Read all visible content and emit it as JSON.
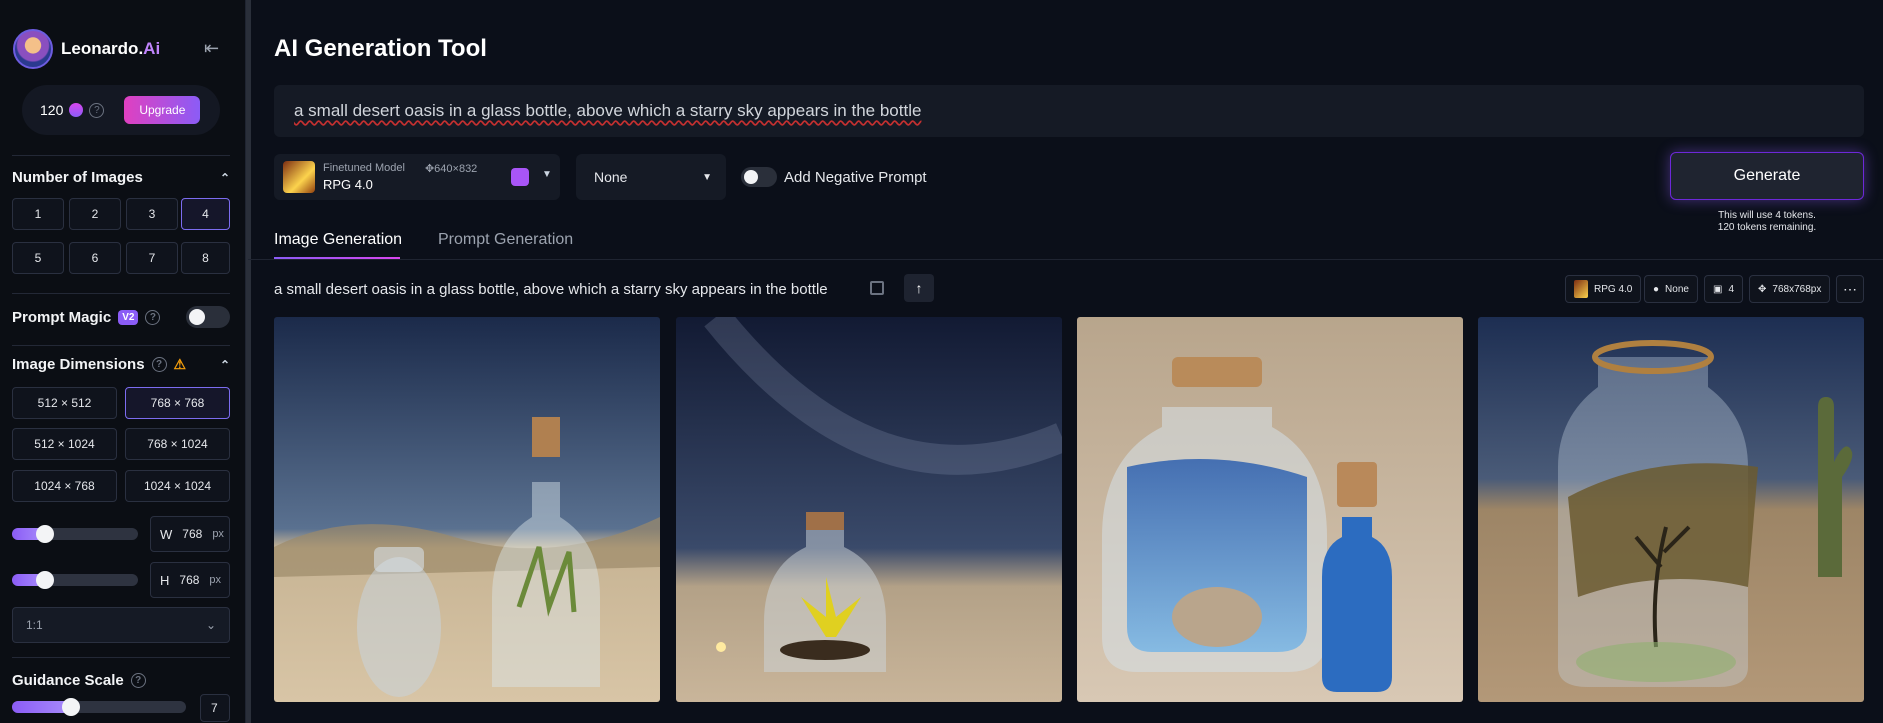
{
  "brand": {
    "name_main": "Leonardo.",
    "name_ai": "Ai"
  },
  "tokens": {
    "count": "120",
    "upgrade_label": "Upgrade"
  },
  "num_images": {
    "title": "Number of Images",
    "options": [
      "1",
      "2",
      "3",
      "4",
      "5",
      "6",
      "7",
      "8"
    ],
    "selected": "4"
  },
  "prompt_magic": {
    "title": "Prompt Magic",
    "badge": "V2",
    "enabled": false
  },
  "image_dimensions": {
    "title": "Image Dimensions",
    "options": [
      "512 × 512",
      "768 × 768",
      "512 × 1024",
      "768 × 1024",
      "1024 × 768",
      "1024 × 1024"
    ],
    "selected": "768 × 768",
    "width_label": "W",
    "width_value": "768",
    "height_label": "H",
    "height_value": "768",
    "unit": "px",
    "aspect_ratio": "1:1"
  },
  "guidance": {
    "title": "Guidance Scale",
    "value": "7"
  },
  "main": {
    "title": "AI Generation Tool",
    "prompt": "a small desert oasis in a glass bottle, above which a starry sky appears in the bottle",
    "model": {
      "label": "Finetuned Model",
      "dims": "640×832",
      "name": "RPG 4.0"
    },
    "style": "None",
    "negative_prompt_label": "Add Negative Prompt",
    "generate_label": "Generate",
    "generate_note_1": "This will use 4 tokens.",
    "generate_note_2": "120 tokens remaining.",
    "tabs": [
      "Image Generation",
      "Prompt Generation"
    ],
    "active_tab": "Image Generation"
  },
  "generation": {
    "prompt": "a small desert oasis in a glass bottle, above which a starry sky appears in the bottle",
    "chips": {
      "model": "RPG 4.0",
      "style": "None",
      "count": "4",
      "size": "768x768px"
    },
    "images": [
      "desert-bottle-1",
      "desert-bottle-2",
      "desert-bottle-3",
      "desert-bottle-4"
    ]
  },
  "colors": {
    "accent": "#8b5cf6",
    "accent_pink": "#d946ef",
    "bg": "#0b0f19",
    "panel": "#151a25"
  }
}
